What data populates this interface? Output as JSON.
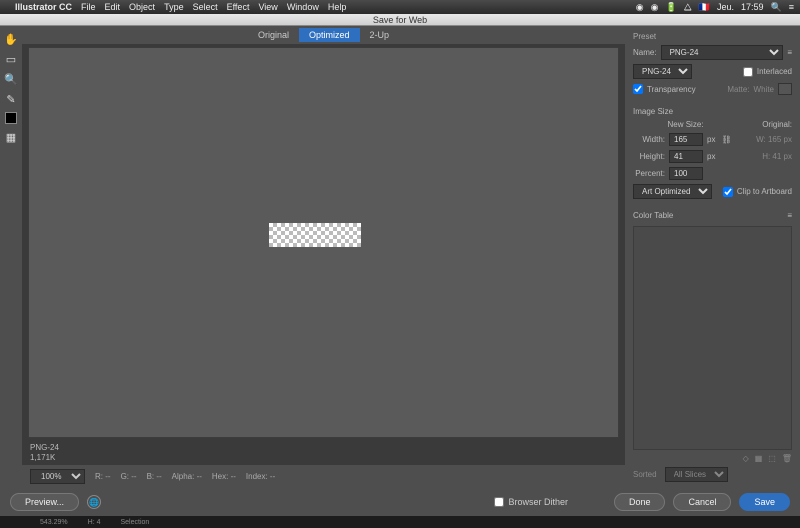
{
  "menubar": {
    "app": "Illustrator CC",
    "items": [
      "File",
      "Edit",
      "Object",
      "Type",
      "Select",
      "Effect",
      "View",
      "Window",
      "Help"
    ],
    "right": {
      "battery": "⌁⌁⌁",
      "net": "≡",
      "flag": "🇫🇷",
      "day": "Jeu.",
      "time": "17:59",
      "user": "◯"
    }
  },
  "window_title": "Save for Web",
  "tabs": {
    "original": "Original",
    "optimized": "Optimized",
    "twoup": "2-Up"
  },
  "canvas_info": {
    "format": "PNG-24",
    "size": "1,171K"
  },
  "bottom": {
    "zoom": "100%",
    "r": "R: --",
    "g": "G: --",
    "b": "B: --",
    "alpha": "Alpha: --",
    "hex": "Hex: --",
    "index": "Index: --"
  },
  "browser_dither": "Browser Dither",
  "footer": {
    "preview": "Preview...",
    "done": "Done",
    "cancel": "Cancel",
    "save": "Save"
  },
  "preset": {
    "title": "Preset",
    "name_label": "Name:",
    "name_value": "PNG-24",
    "format": "PNG-24",
    "interlaced": "Interlaced",
    "transparency": "Transparency",
    "matte": "Matte:",
    "matte_value": "White"
  },
  "image_size": {
    "title": "Image Size",
    "new_size": "New Size:",
    "original": "Original:",
    "width_label": "Width:",
    "width": "165",
    "wo": "W: 165 px",
    "height_label": "Height:",
    "height": "41",
    "ho": "H: 41 px",
    "percent_label": "Percent:",
    "percent": "100",
    "px": "px",
    "quality": "Art Optimized",
    "clip": "Clip to Artboard"
  },
  "color_table": {
    "title": "Color Table",
    "sorted": "Sorted",
    "all_slices": "All Slices"
  },
  "taskbar": {
    "zoom": "543.29%",
    "cursor": "H: 4",
    "selection": "Selection"
  }
}
